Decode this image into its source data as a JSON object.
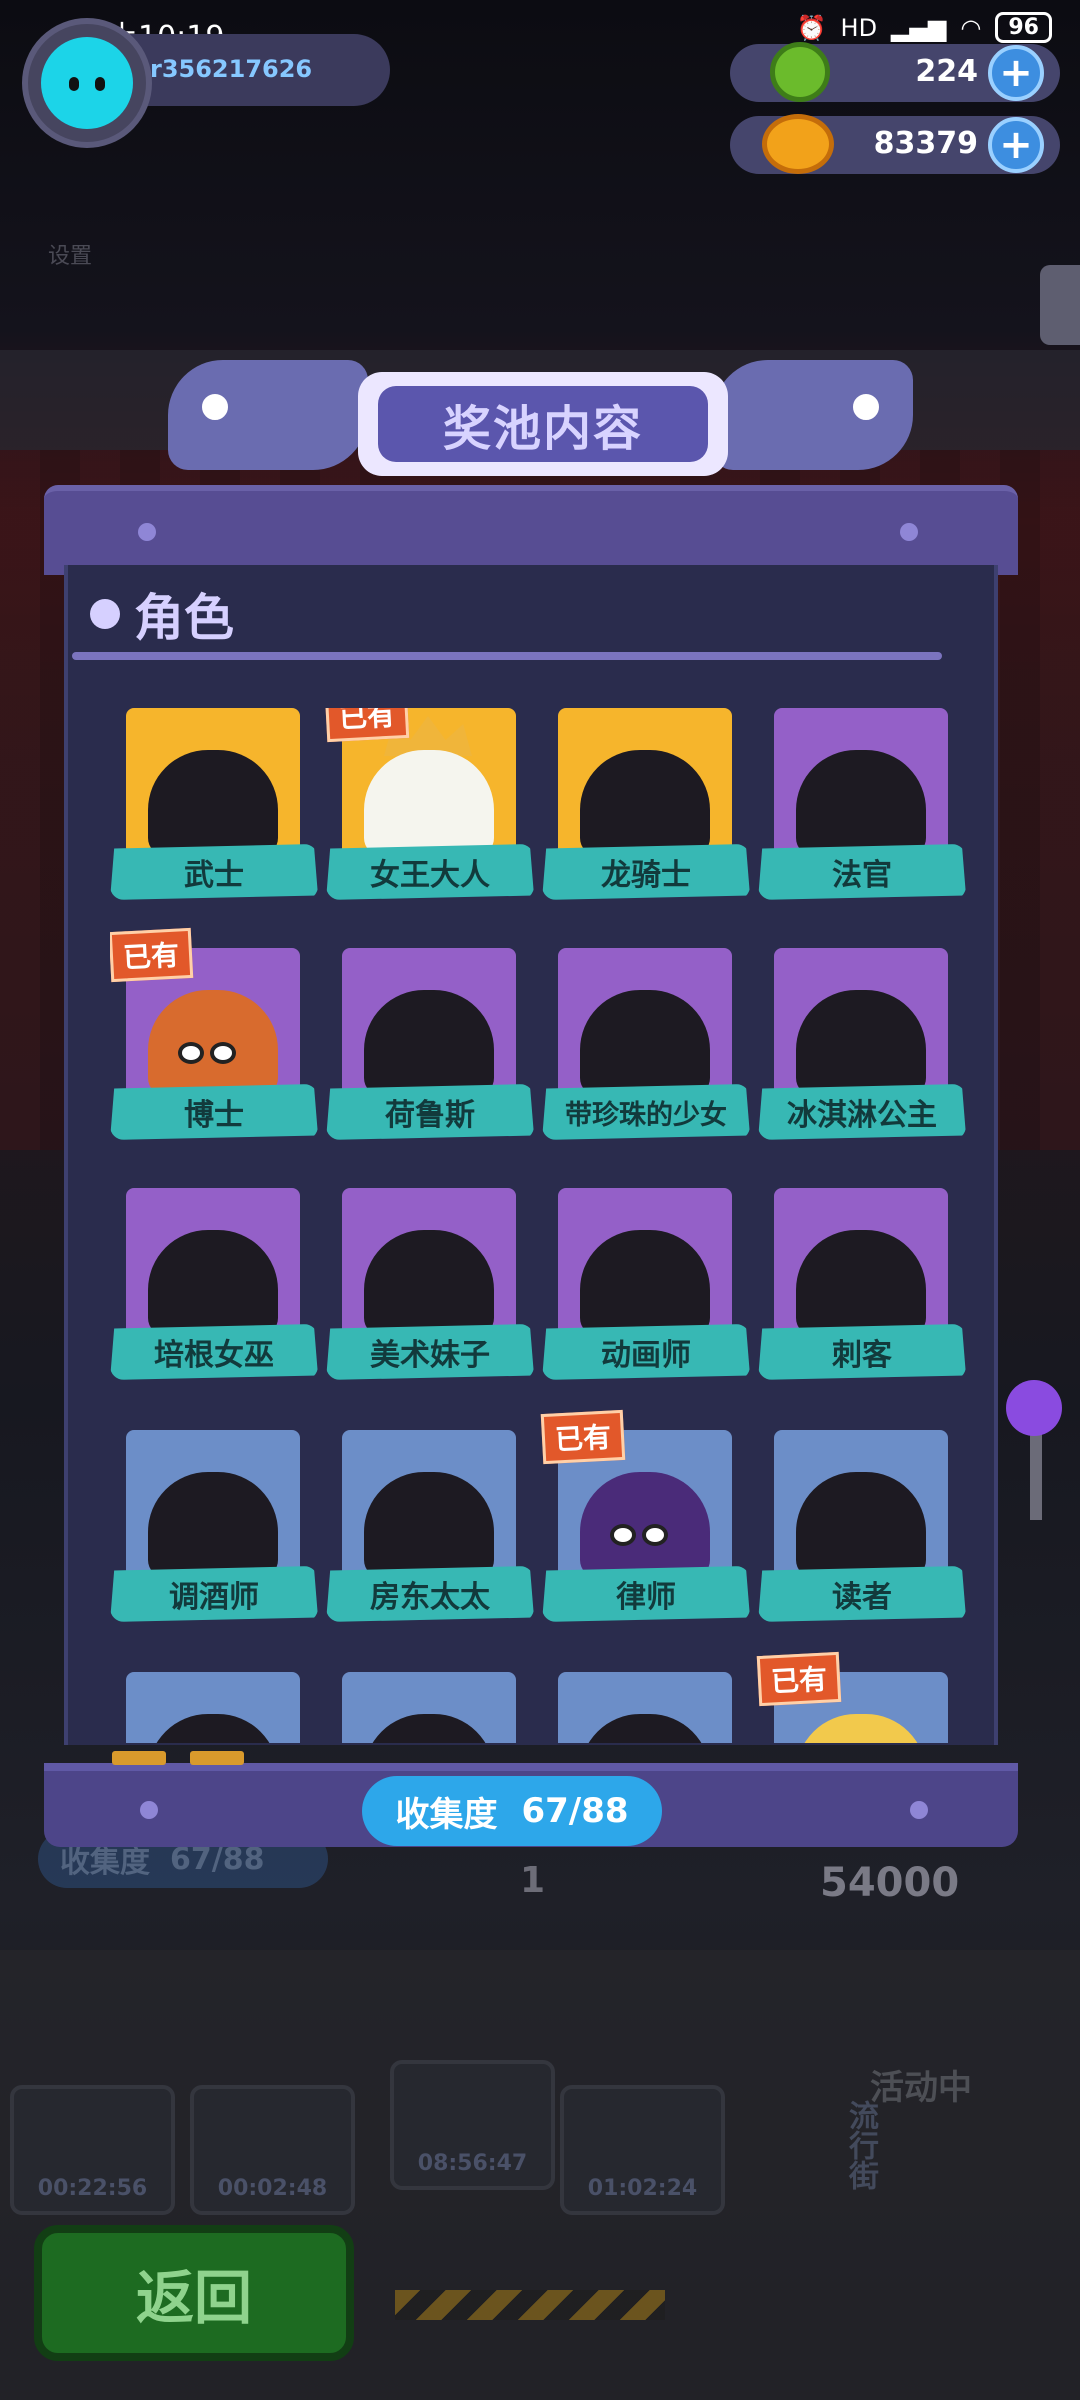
{
  "status_bar": {
    "time": "晚上10:19",
    "network": "HD",
    "battery": "96"
  },
  "player": {
    "id": "r356217626"
  },
  "currencies": [
    {
      "name": "green-gem",
      "value": "224",
      "color": "#6bbb2c"
    },
    {
      "name": "gold-coin",
      "value": "83379",
      "color": "#f2a21a"
    }
  ],
  "background": {
    "settings_label": "设置",
    "collect_label": "收集度",
    "collect_value": "67/88",
    "count": "1",
    "price": "54000",
    "timers": [
      "00:22:56",
      "00:02:48",
      "08:56:47",
      "01:02:24"
    ],
    "event_label": "活动中",
    "street_label": "流行街",
    "back_label": "返回"
  },
  "modal": {
    "title": "奖池内容",
    "section_title": "角色",
    "collect_label": "收集度",
    "collect_value": "67/88",
    "owned_label": "已有"
  },
  "characters": [
    {
      "name": "武士",
      "tier": "gold",
      "owned": false
    },
    {
      "name": "女王大人",
      "tier": "gold",
      "owned": true
    },
    {
      "name": "龙骑士",
      "tier": "gold",
      "owned": false
    },
    {
      "name": "法官",
      "tier": "purple",
      "owned": false
    },
    {
      "name": "博士",
      "tier": "purple",
      "owned": true
    },
    {
      "name": "荷鲁斯",
      "tier": "purple",
      "owned": false
    },
    {
      "name": "带珍珠的少女",
      "tier": "purple",
      "owned": false
    },
    {
      "name": "冰淇淋公主",
      "tier": "purple",
      "owned": false
    },
    {
      "name": "培根女巫",
      "tier": "purple",
      "owned": false
    },
    {
      "name": "美术妹子",
      "tier": "purple",
      "owned": false
    },
    {
      "name": "动画师",
      "tier": "purple",
      "owned": false
    },
    {
      "name": "刺客",
      "tier": "purple",
      "owned": false
    },
    {
      "name": "调酒师",
      "tier": "blue",
      "owned": false
    },
    {
      "name": "房东太太",
      "tier": "blue",
      "owned": false
    },
    {
      "name": "律师",
      "tier": "blue",
      "owned": true
    },
    {
      "name": "读者",
      "tier": "blue",
      "owned": false
    },
    {
      "name": "",
      "tier": "blue",
      "owned": false
    },
    {
      "name": "",
      "tier": "blue",
      "owned": false
    },
    {
      "name": "",
      "tier": "blue",
      "owned": false
    },
    {
      "name": "",
      "tier": "blue",
      "owned": true
    }
  ]
}
